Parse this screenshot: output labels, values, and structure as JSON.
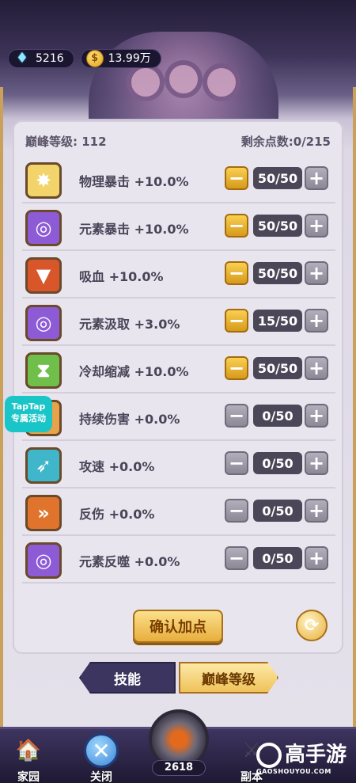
{
  "resources": {
    "diamonds": "5216",
    "coins": "13.99万"
  },
  "header": {
    "peak_level_label": "巅峰等级:",
    "peak_level_value": "112",
    "remaining_label": "剩余点数:",
    "remaining_value": "0/215"
  },
  "skills": [
    {
      "name": "物理暴击 +10.0%",
      "value": "50/50",
      "minus_active": true,
      "icon": "burst-icon",
      "color": "#f2d46b"
    },
    {
      "name": "元素暴击 +10.0%",
      "value": "50/50",
      "minus_active": true,
      "icon": "vortex-icon",
      "color": "#8e5bd6"
    },
    {
      "name": "吸血 +10.0%",
      "value": "50/50",
      "minus_active": true,
      "icon": "fangs-icon",
      "color": "#d9562a"
    },
    {
      "name": "元素汲取 +3.0%",
      "value": "15/50",
      "minus_active": true,
      "icon": "vortex-icon",
      "color": "#8e5bd6"
    },
    {
      "name": "冷却缩减 +10.0%",
      "value": "50/50",
      "minus_active": true,
      "icon": "hourglass-icon",
      "color": "#6fbf4a"
    },
    {
      "name": "持续伤害 +0.0%",
      "value": "0/50",
      "minus_active": false,
      "icon": "flame-icon",
      "color": "#e8a24a"
    },
    {
      "name": "攻速 +0.0%",
      "value": "0/50",
      "minus_active": false,
      "icon": "wind-icon",
      "color": "#3fb6c9"
    },
    {
      "name": "反伤 +0.0%",
      "value": "0/50",
      "minus_active": false,
      "icon": "reflect-icon",
      "color": "#e0742c"
    },
    {
      "name": "元素反噬 +0.0%",
      "value": "0/50",
      "minus_active": false,
      "icon": "vortex-icon",
      "color": "#8e5bd6"
    }
  ],
  "buttons": {
    "minus": "−",
    "plus": "+",
    "confirm": "确认加点",
    "reset": "⟳"
  },
  "tabs": {
    "skill": "技能",
    "peak": "巅峰等级"
  },
  "taptap": {
    "line1": "TapTap",
    "line2": "专属活动"
  },
  "bottom_nav": {
    "home": "家园",
    "close": "关闭",
    "level": "2618",
    "dungeon": "副本"
  },
  "watermark": {
    "brand": "高手游",
    "url": "GAOSHOUYOU.COM"
  }
}
